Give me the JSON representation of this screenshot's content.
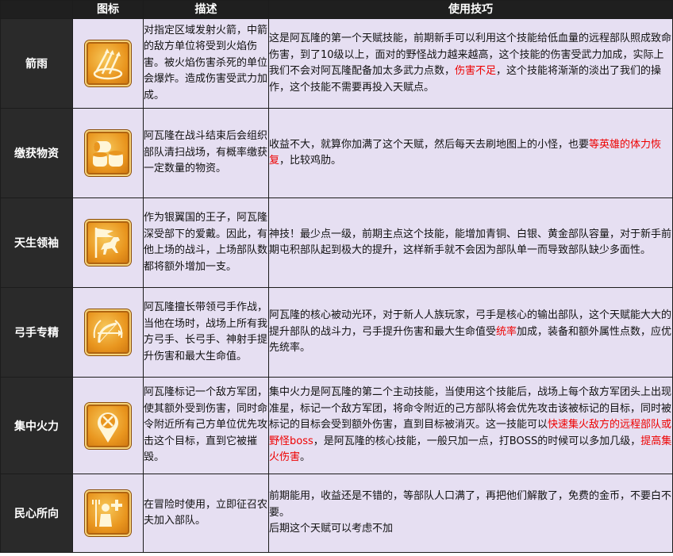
{
  "header": {
    "col_icon": "图标",
    "col_desc": "描述",
    "col_tip": "使用技巧"
  },
  "rows": [
    {
      "name": "箭雨",
      "icon": "arrow-rain-icon",
      "desc": "对指定区域发射火箭，中箭的敌方单位将受到火焰伤害。被火焰伤害杀死的单位会爆炸。造成伤害受武力加成。",
      "tip": [
        {
          "t": "这是阿瓦隆的第一个天赋技能，前期新手可以利用这个技能给低血量的远程部队照成致命伤害，到了10级以上，面对的野怪战力越来越高，这个技能的伤害受武力加成，实际上我们不会对阿瓦隆配备加太多武力点数，",
          "red": false
        },
        {
          "t": "伤害不足",
          "red": true
        },
        {
          "t": "，这个技能将渐渐的淡出了我们的操作，这个技能不需要再投入天赋点。",
          "red": false
        }
      ]
    },
    {
      "name": "缴获物资",
      "icon": "supplies-icon",
      "desc": "阿瓦隆在战斗结束后会组织部队清扫战场，有概率缴获一定数量的物资。",
      "tip": [
        {
          "t": "收益不大，就算你加满了这个天赋，然后每天去刷地图上的小怪，也要",
          "red": false
        },
        {
          "t": "等英雄的体力恢复",
          "red": true
        },
        {
          "t": "，比较鸡肋。",
          "red": false
        }
      ]
    },
    {
      "name": "天生领袖",
      "icon": "horse-banner-icon",
      "desc": "作为银翼国的王子，阿瓦隆深受部下的爱戴。因此，有他上场的战斗，上场部队数都将额外增加一支。",
      "tip": [
        {
          "t": "神技！最少点一级，前期主点这个技能，能增加青铜、白银、黄金部队容量，对于新手前期屯积部队起到极大的提升，这样新手就不会因为部队单一而导致部队缺少多面性。",
          "red": false
        }
      ]
    },
    {
      "name": "弓手专精",
      "icon": "bow-wreath-icon",
      "desc": "阿瓦隆擅长带领弓手作战，当他在场时，战场上所有我方弓手、长弓手、神射手提升伤害和最大生命值。",
      "tip": [
        {
          "t": "阿瓦隆的核心被动光环，对于新人人族玩家，弓手是核心的输出部队，这个天赋能大大的提升部队的战斗力，弓手提升伤害和最大生命值受",
          "red": false
        },
        {
          "t": "统率",
          "red": true
        },
        {
          "t": "加成，装备和额外属性点数，应优先统率。",
          "red": false
        }
      ]
    },
    {
      "name": "集中火力",
      "icon": "target-marker-icon",
      "desc": "阿瓦隆标记一个敌方军团，使其额外受到伤害，同时命令附近所有己方单位优先攻击这个目标，直到它被摧毁。",
      "tip": [
        {
          "t": "集中火力是阿瓦隆的第二个主动技能，当使用这个技能后，战场上每个敌方军团头上出现准星，标记一个敌方军团，将命令附近的己方部队将会优先攻击该被标记的目标，同时被标记的目标会受到额外伤害，直到目标被消灭。这一技能可以",
          "red": false
        },
        {
          "t": "快速集火敌方的远程部队或野怪boss",
          "red": true
        },
        {
          "t": "，是阿瓦隆的核心技能，一般只加一点，打BOSS的时候可以多加几级，",
          "red": false
        },
        {
          "t": "提高集火伤害",
          "red": true
        },
        {
          "t": "。",
          "red": false
        }
      ]
    },
    {
      "name": "民心所向",
      "icon": "peasant-plus-icon",
      "desc": "在冒险时使用，立即征召农夫加入部队。",
      "tip": [
        {
          "t": "前期能用，收益还是不错的，等部队人口满了，再把他们解散了，免费的金币，不要白不要。",
          "red": false
        },
        {
          "br": true
        },
        {
          "t": "后期这个天赋可以考虑不加",
          "red": false
        }
      ]
    }
  ]
}
